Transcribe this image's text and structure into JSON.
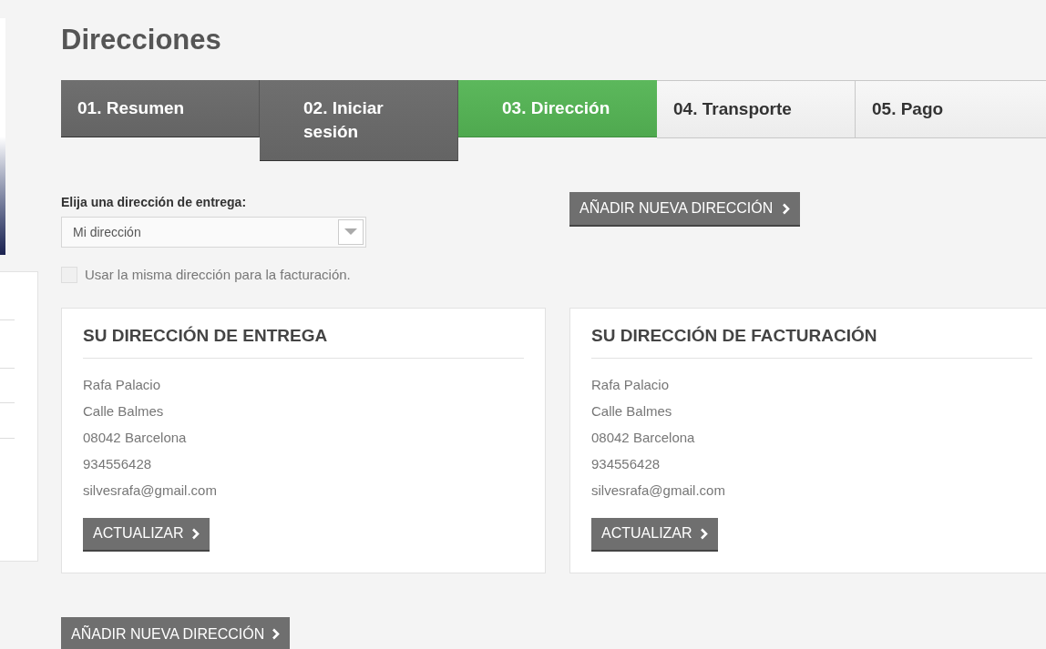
{
  "title": "Direcciones",
  "steps": [
    {
      "label": "01. Resumen",
      "kind": "done"
    },
    {
      "label": "02. Iniciar sesión",
      "kind": "done"
    },
    {
      "label": "03. Dirección",
      "kind": "current"
    },
    {
      "label": "04. Transporte",
      "kind": "todo"
    },
    {
      "label": "05. Pago",
      "kind": "todo"
    }
  ],
  "delivery_select": {
    "label": "Elija una dirección de entrega:",
    "value": "Mi dirección"
  },
  "same_address": {
    "label": "Usar la misma dirección para la facturación.",
    "checked": false
  },
  "add_button_top": "AÑADIR NUEVA DIRECCIÓN",
  "cards": [
    {
      "title": "SU DIRECCIÓN DE ENTREGA",
      "lines": [
        "Rafa Palacio",
        "Calle Balmes",
        "08042 Barcelona",
        "934556428",
        "silvesrafa@gmail.com"
      ],
      "button": "ACTUALIZAR"
    },
    {
      "title": "SU DIRECCIÓN DE FACTURACIÓN",
      "lines": [
        "Rafa Palacio",
        "Calle Balmes",
        "08042 Barcelona",
        "934556428",
        "silvesrafa@gmail.com"
      ],
      "button": "ACTUALIZAR"
    }
  ],
  "add_button_bottom": "AÑADIR NUEVA DIRECCIÓN"
}
